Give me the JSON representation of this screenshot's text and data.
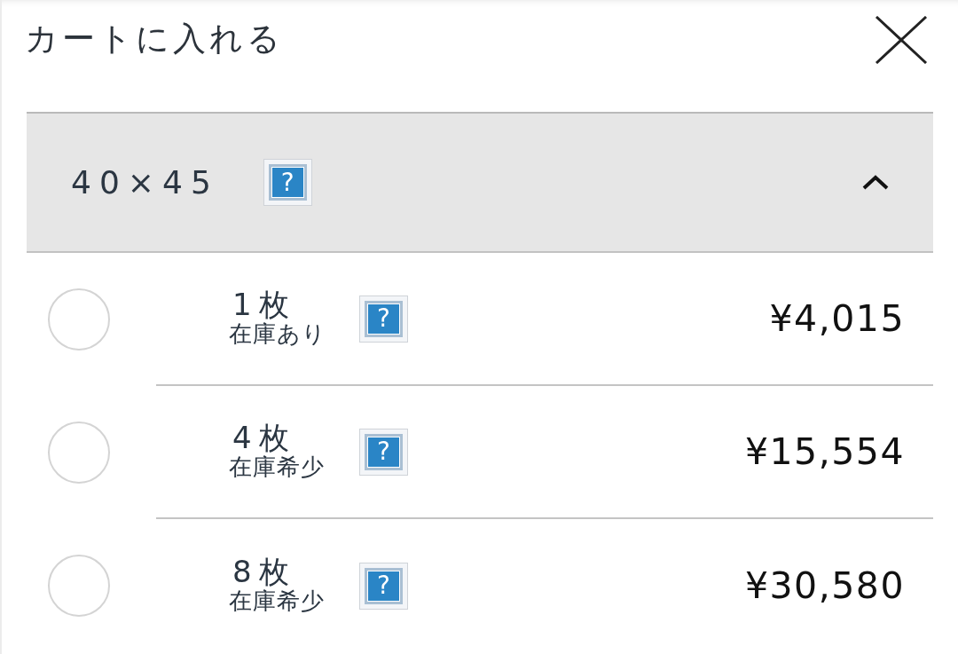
{
  "dialog": {
    "title": "カートに入れる"
  },
  "size_group": {
    "label": "40×45",
    "help": "?",
    "expanded": true
  },
  "options": [
    {
      "quantity": "1枚",
      "stock": "在庫あり",
      "help": "?",
      "price": "¥4,015",
      "selected": false
    },
    {
      "quantity": "4枚",
      "stock": "在庫希少",
      "help": "?",
      "price": "¥15,554",
      "selected": false
    },
    {
      "quantity": "8枚",
      "stock": "在庫希少",
      "help": "?",
      "price": "¥30,580",
      "selected": false
    }
  ]
}
